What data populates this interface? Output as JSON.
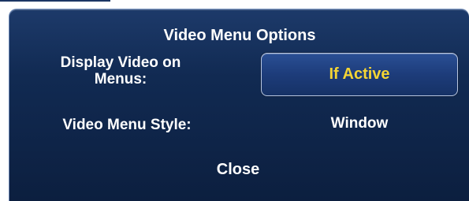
{
  "dialog": {
    "title": "Video Menu Options",
    "display_video": {
      "label_line1": "Display Video on",
      "label_line2": "Menus:",
      "value": "If Active"
    },
    "video_menu_style": {
      "label": "Video Menu Style:",
      "value": "Window"
    },
    "close_label": "Close"
  },
  "colors": {
    "panel_top": "#1d3a6a",
    "panel_bottom": "#0c1f3f",
    "highlight_text": "#f4d534",
    "text": "#ffffff",
    "button_border": "#b9c7e0"
  }
}
